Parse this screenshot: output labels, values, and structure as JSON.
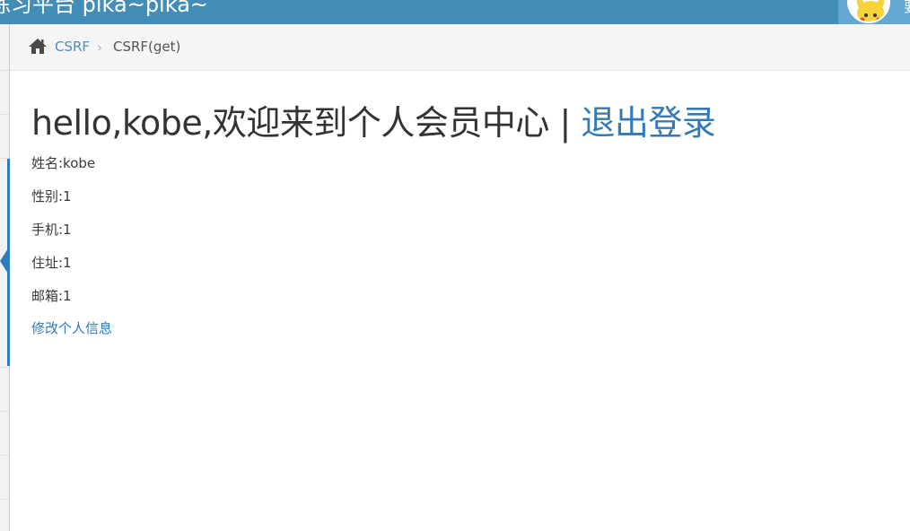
{
  "header": {
    "brand": "练习平台 pika~pika~",
    "user_initial": "要"
  },
  "breadcrumb": {
    "link": "CSRF",
    "separator": "›",
    "current": "CSRF(get)"
  },
  "main": {
    "greeting": "hello,kobe,欢迎来到个人会员中心 | ",
    "logout": "退出登录",
    "name": "姓名:kobe",
    "gender": "性别:1",
    "phone": "手机:1",
    "address": "住址:1",
    "email": "邮箱:1",
    "edit_link": "修改个人信息"
  },
  "colors": {
    "topbar": "#438eb9",
    "link": "#337ab7",
    "sidebar_active": "#2b7dbc"
  }
}
